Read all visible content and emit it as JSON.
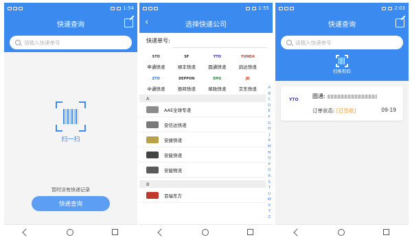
{
  "screens": [
    {
      "status_time": "1:54",
      "title": "快递查询",
      "search_placeholder": "请输入快递单号",
      "scan_label": "扫一扫",
      "empty_text": "暂时没有快递记录",
      "query_button": "快递查询"
    },
    {
      "status_time": "1:55",
      "title": "选择快递公司",
      "order_label": "快递单号:",
      "popular": [
        {
          "name": "申通快递",
          "logo": "STO",
          "color": "#333333"
        },
        {
          "name": "顺丰快递",
          "logo": "SF",
          "color": "#222222"
        },
        {
          "name": "圆通快递",
          "logo": "YTO",
          "color": "#3a2aa8"
        },
        {
          "name": "韵达快递",
          "logo": "YUNDA",
          "color": "#d33a2c"
        },
        {
          "name": "中通快递",
          "logo": "ZTO",
          "color": "#2a6fd6"
        },
        {
          "name": "德邦快递",
          "logo": "DEPPON",
          "color": "#333333"
        },
        {
          "name": "邮政快递",
          "logo": "EMS",
          "color": "#2d8b3a"
        },
        {
          "name": "京东快递",
          "logo": "JD",
          "color": "#d33a2c"
        }
      ],
      "alphabet": [
        "A",
        "B",
        "C",
        "D",
        "E",
        "F",
        "G",
        "H",
        "J",
        "K",
        "M",
        "N",
        "O",
        "P",
        "Q",
        "R",
        "S",
        "T",
        "U",
        "W",
        "X",
        "Y",
        "Z"
      ],
      "sections": [
        {
          "letter": "A",
          "items": [
            {
              "name": "AAE全球专递",
              "color": "#8c8c8c"
            },
            {
              "name": "安信达快递",
              "color": "#7a7a7a"
            },
            {
              "name": "安捷快递",
              "color": "#b8a14a"
            },
            {
              "name": "安能快递",
              "color": "#444444"
            },
            {
              "name": "安能物流",
              "color": "#5a5a5a"
            }
          ]
        },
        {
          "letter": "B",
          "items": [
            {
              "name": "百福东方",
              "color": "#c0392b"
            }
          ]
        }
      ]
    },
    {
      "status_time": "2:03",
      "title": "快递查询",
      "search_placeholder": "请输入快递单号",
      "scan_label": "扫条形码",
      "record": {
        "company_prefix": "圆通:",
        "status_label": "订单状态:",
        "status_value": "[已签收]",
        "date": "09-19",
        "logo": "YTO"
      }
    }
  ]
}
